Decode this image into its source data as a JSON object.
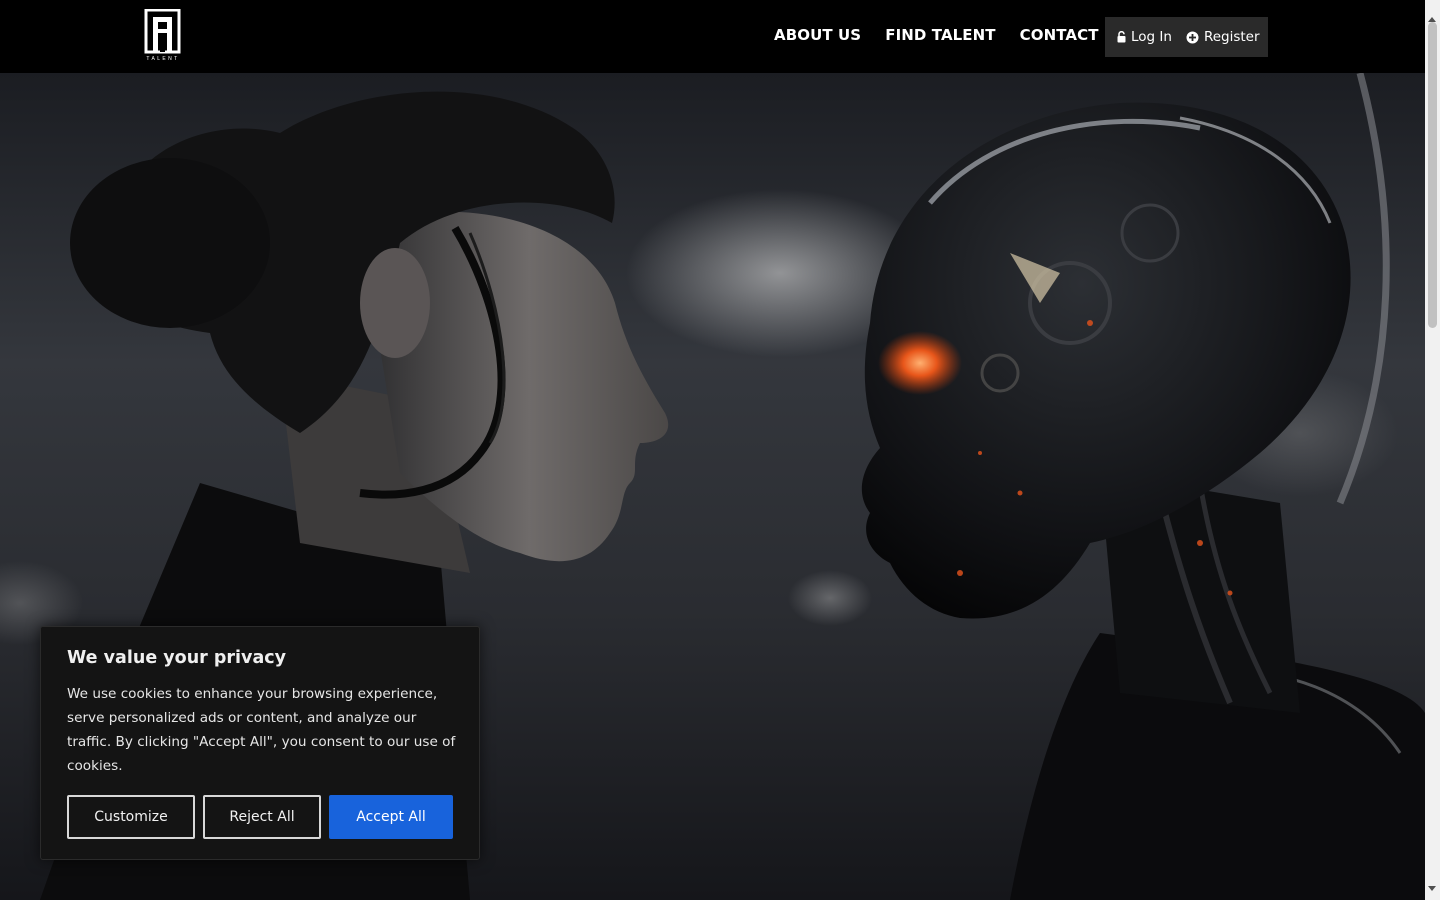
{
  "brand": {
    "logo_text": "TALENT"
  },
  "nav": {
    "items": [
      {
        "label": "ABOUT US"
      },
      {
        "label": "FIND TALENT"
      },
      {
        "label": "CONTACT US"
      }
    ]
  },
  "auth": {
    "login_label": "Log In",
    "login_icon": "lock-icon",
    "register_label": "Register",
    "register_icon": "plus-circle-icon"
  },
  "cookie_banner": {
    "title": "We value your privacy",
    "body": "We use cookies to enhance your browsing experience, serve personalized ads or content, and analyze our traffic. By clicking \"Accept All\", you consent to our use of cookies.",
    "customize_label": "Customize",
    "reject_label": "Reject All",
    "accept_label": "Accept All",
    "accept_color": "#1863dc"
  },
  "hero": {
    "image": "woman-and-robot-face-to-face"
  }
}
